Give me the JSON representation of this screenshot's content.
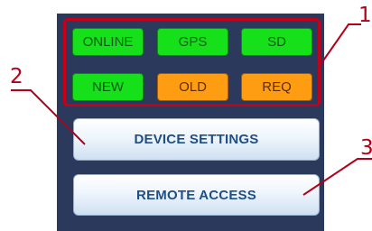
{
  "status_indicators": [
    {
      "label": "ONLINE",
      "state": "green"
    },
    {
      "label": "GPS",
      "state": "green"
    },
    {
      "label": "SD",
      "state": "green"
    },
    {
      "label": "NEW",
      "state": "green"
    },
    {
      "label": "OLD",
      "state": "orange"
    },
    {
      "label": "REQ",
      "state": "orange"
    }
  ],
  "buttons": {
    "device_settings": "DEVICE SETTINGS",
    "remote_access": "REMOTE ACCESS"
  },
  "callouts": [
    "1",
    "2",
    "3"
  ],
  "colors": {
    "panel_bg": "#2b3a5c",
    "frame_red": "#c4001a",
    "led_green": "#16e01a",
    "led_orange": "#ff9d12",
    "button_text": "#1f4f86"
  }
}
